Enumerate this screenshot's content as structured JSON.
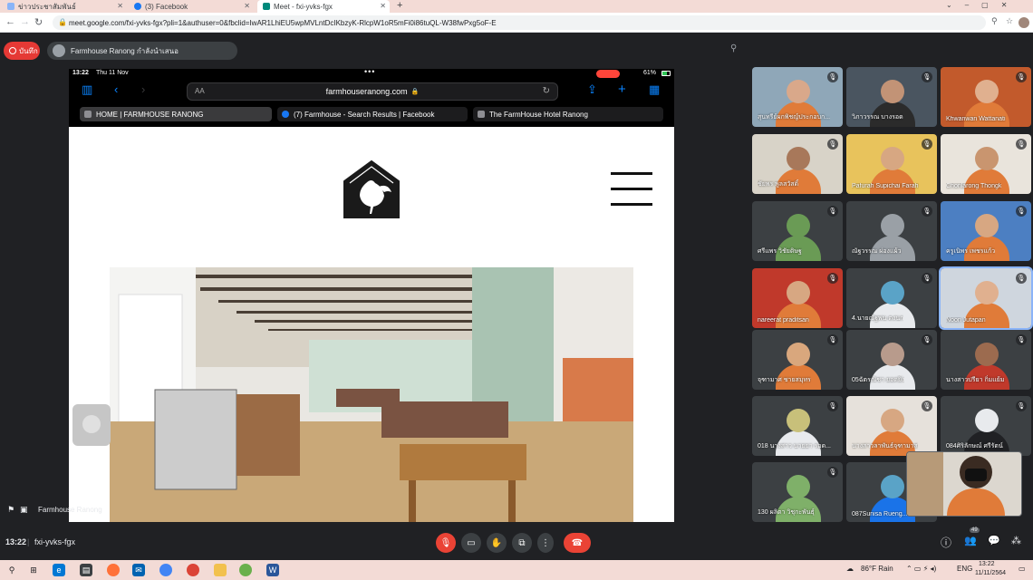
{
  "browser": {
    "tabs": [
      {
        "title": "ข่าวประชาสัมพันธ์",
        "color": "#8ab4f8"
      },
      {
        "title": "(3) Facebook",
        "color": "#1877f2"
      },
      {
        "title": "Meet - fxi-yvks-fgx",
        "color": "#00897b"
      }
    ],
    "url": "meet.google.com/fxi-yvks-fgx?pli=1&authuser=0&fbclid=IwAR1LhiEU5wpMVLntDcIKbzyK-RlcpW1oR5mFi0i86tuQL-W38fwPxg5oF-E"
  },
  "meet": {
    "record_label": "บันทึก",
    "presenter_text": "Farmhouse Ranong กำลังนำเสนอ",
    "presenter_caption": "Farmhouse Ranong",
    "time": "13:22",
    "meeting_code": "fxi-yvks-fgx",
    "participant_count": "49"
  },
  "ipad": {
    "status_time": "13:22",
    "status_date": "Thu 11 Nov",
    "battery": "61%",
    "text_size": "AA",
    "url": "farmhouseranong.com",
    "tabs": [
      {
        "title": "HOME | FARMHOUSE RANONG",
        "color": "#8e8e93"
      },
      {
        "title": "(7) Farmhouse - Search Results | Facebook",
        "color": "#1877f2"
      },
      {
        "title": "The FarmHouse Hotel Ranong",
        "color": "#8e8e93"
      }
    ]
  },
  "participants": [
    {
      "name": "สุนทรีย์ผกพิชญ์ประกอบก...",
      "face": "#d9a88a",
      "bg": "#8fa7b8",
      "shirt": "#e07b39"
    },
    {
      "name": "วิภาวรรณ บางรอด",
      "face": "#c29376",
      "bg": "#4a5560",
      "shirt": "#2b2b2b"
    },
    {
      "name": "Khwanwan Wattanati",
      "face": "#e0b08f",
      "bg": "#c25a2c",
      "shirt": "#e07b39"
    },
    {
      "name": "ชัยพร พูลสวัสดิ์",
      "face": "#a8785a",
      "bg": "#d8d3c8",
      "shirt": "#e07b39"
    },
    {
      "name": "Pafurah Supichai Farah",
      "face": "#d7a782",
      "bg": "#e8c35c",
      "shirt": "#e07b39"
    },
    {
      "name": "Chonlarong Thongk",
      "face": "#c9956f",
      "bg": "#e9e4dc",
      "shirt": "#e07b39"
    },
    {
      "name": "ศรีแพร วิชัยดิษฐ",
      "face": "#6a9b55",
      "bg": "#3c4043",
      "shirt": "#6a9b55"
    },
    {
      "name": "ณัฐวรรณ ผ่องแผ้ว",
      "face": "#9aa0a6",
      "bg": "#3c4043",
      "shirt": "#9aa0a6"
    },
    {
      "name": "ครูเนิพร เพชรแก้ว",
      "face": "#d7a782",
      "bg": "#4c7fc2",
      "shirt": "#e07b39"
    },
    {
      "name": "nareerat praditsan",
      "face": "#d7a782",
      "bg": "#c0392b",
      "shirt": "#e07b39"
    },
    {
      "name": "4.นายณัฐพน ตงนก",
      "face": "#5aa3c7",
      "bg": "#3c4043",
      "shirt": "#e8eaed"
    },
    {
      "name": "Noon Jutapan",
      "face": "#e0b08f",
      "bg": "#cfd6de",
      "shirt": "#e07b39"
    },
    {
      "name": "จุฑามาศ ชายสมุทร",
      "face": "#d9a77d",
      "bg": "#3c4043",
      "shirt": "#e07b39"
    },
    {
      "name": "05ฉัตรณิชา ยอดยิ่ง",
      "face": "#b89b8c",
      "bg": "#3c4043",
      "shirt": "#e8eaed"
    },
    {
      "name": "นางสาวปรียา กิ่มแย้ม",
      "face": "#9c6b4f",
      "bg": "#3c4043",
      "shirt": "#c0392b"
    },
    {
      "name": "018 นางสาว นายยา รอด...",
      "face": "#c8c07a",
      "bg": "#3c4043",
      "shirt": "#e8eaed"
    },
    {
      "name": "นางสาวลาพันธ์จุฑามาส",
      "face": "#d7a782",
      "bg": "#e6e1db",
      "shirt": "#e07b39"
    },
    {
      "name": "084ศิริลักษณ์ ศรีรัตน์",
      "face": "#e8eaed",
      "bg": "#3c4043",
      "shirt": "#202124"
    },
    {
      "name": "130 ผลิตา วิชุกะพันธุ์",
      "face": "#7fb069",
      "bg": "#3c4043",
      "shirt": "#7fb069"
    },
    {
      "name": "087Sunisa Rueng...",
      "face": "#5aa3c7",
      "bg": "#3c4043",
      "shirt": "#1a73e8"
    }
  ],
  "taskbar": {
    "weather": "86°F  Rain",
    "lang": "ENG",
    "clock_time": "13:22",
    "clock_date": "11/11/2564"
  }
}
